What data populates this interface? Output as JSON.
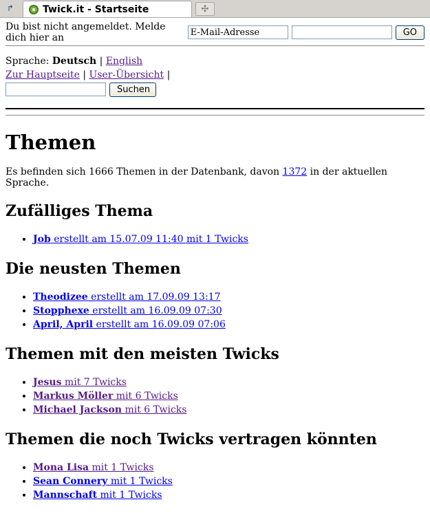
{
  "browser": {
    "tab_title": "Twick.it - Startseite",
    "newtab_glyph": "✣",
    "scroll_glyph": "↱"
  },
  "login": {
    "prompt": "Du bist nicht angemeldet. Melde dich hier an",
    "email_value": "E-Mail-Adresse",
    "password_value": "",
    "go_label": "GO"
  },
  "language": {
    "label": "Sprache:",
    "current": "Deutsch",
    "separator": "|",
    "other": "English"
  },
  "nav": {
    "home": "Zur Hauptseite",
    "users": "User-Übersicht",
    "separator": "|"
  },
  "search": {
    "value": "",
    "button_label": "Suchen"
  },
  "page": {
    "title": "Themen",
    "stats_before": "Es befinden sich 1666 Themen in der Datenbank, davon ",
    "stats_link": "1372",
    "stats_after": " in der aktuellen Sprache."
  },
  "sections": {
    "random": {
      "heading": "Zufälliges Thema",
      "items": [
        {
          "topic": "Job",
          "meta": " erstellt am 15.07.09 11:40 mit 1 Twicks",
          "visited": false
        }
      ]
    },
    "newest": {
      "heading": "Die neusten Themen",
      "items": [
        {
          "topic": "Theodizee",
          "meta": " erstellt am 17.09.09 13:17",
          "visited": false
        },
        {
          "topic": "Stopphexe",
          "meta": " erstellt am 16.09.09 07:30",
          "visited": false
        },
        {
          "topic": "April, April",
          "meta": " erstellt am 16.09.09 07:06",
          "visited": false
        }
      ]
    },
    "most": {
      "heading": "Themen mit den meisten Twicks",
      "items": [
        {
          "topic": "Jesus",
          "meta": " mit 7 Twicks",
          "visited": true
        },
        {
          "topic": "Markus Möller",
          "meta": " mit 6 Twicks",
          "visited": true
        },
        {
          "topic": "Michael Jackson",
          "meta": " mit 6 Twicks",
          "visited": true
        }
      ]
    },
    "needing": {
      "heading": "Themen die noch Twicks vertragen könnten",
      "items": [
        {
          "topic": "Mona Lisa",
          "meta": " mit 1 Twicks",
          "visited": true
        },
        {
          "topic": "Sean Connery",
          "meta": " mit 1 Twicks",
          "visited": false
        },
        {
          "topic": "Mannschaft",
          "meta": " mit 1 Twicks",
          "visited": false
        }
      ]
    }
  },
  "colors": {
    "link": "#0000ee",
    "visited": "#551a8b"
  }
}
